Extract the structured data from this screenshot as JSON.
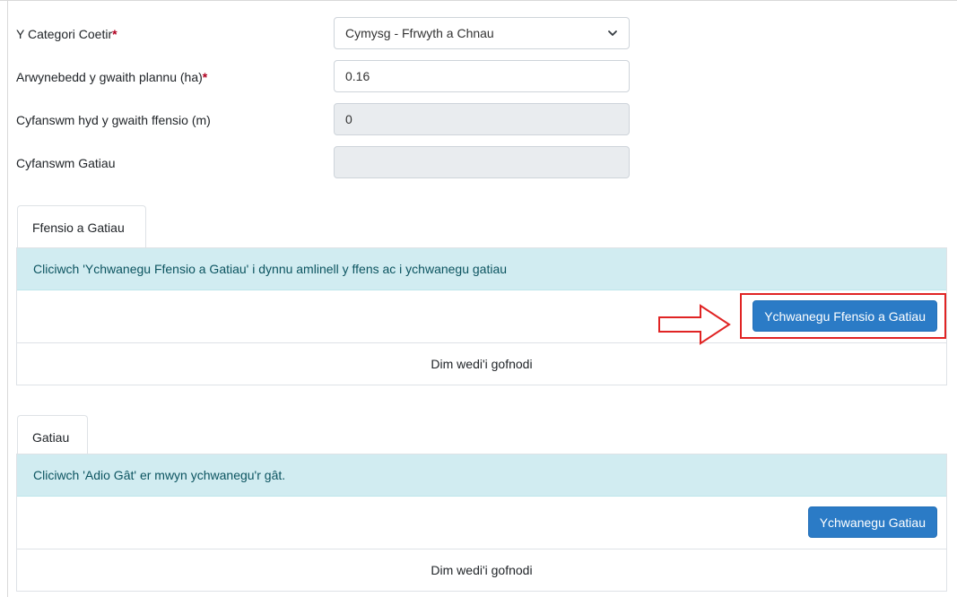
{
  "form": {
    "category": {
      "label": "Y Categori Coetir",
      "required_mark": "*",
      "value": "Cymysg - Ffrwyth a Chnau"
    },
    "planting_area": {
      "label": "Arwynebedd y gwaith plannu (ha)",
      "required_mark": "*",
      "value": "0.16"
    },
    "fencing_total": {
      "label": "Cyfanswm hyd y gwaith ffensio (m)",
      "value": "0"
    },
    "gates_total": {
      "label": "Cyfanswm Gatiau",
      "value": ""
    }
  },
  "fencing_section": {
    "tab_label": "Ffensio a Gatiau",
    "info": "Cliciwch 'Ychwanegu Ffensio a Gatiau' i dynnu amlinell y ffens ac i ychwanegu gatiau",
    "button_label": "Ychwanegu Ffensio a Gatiau",
    "empty_text": "Dim wedi'i gofnodi"
  },
  "gates_section": {
    "tab_label": "Gatiau",
    "info": "Cliciwch 'Adio Gât' er mwyn ychwanegu'r gât.",
    "button_label": "Ychwanegu Gatiau",
    "empty_text": "Dim wedi'i gofnodi"
  },
  "colors": {
    "annotation": "#e02424",
    "primary_button": "#2b7bc6",
    "info_background": "#d1ecf1"
  }
}
